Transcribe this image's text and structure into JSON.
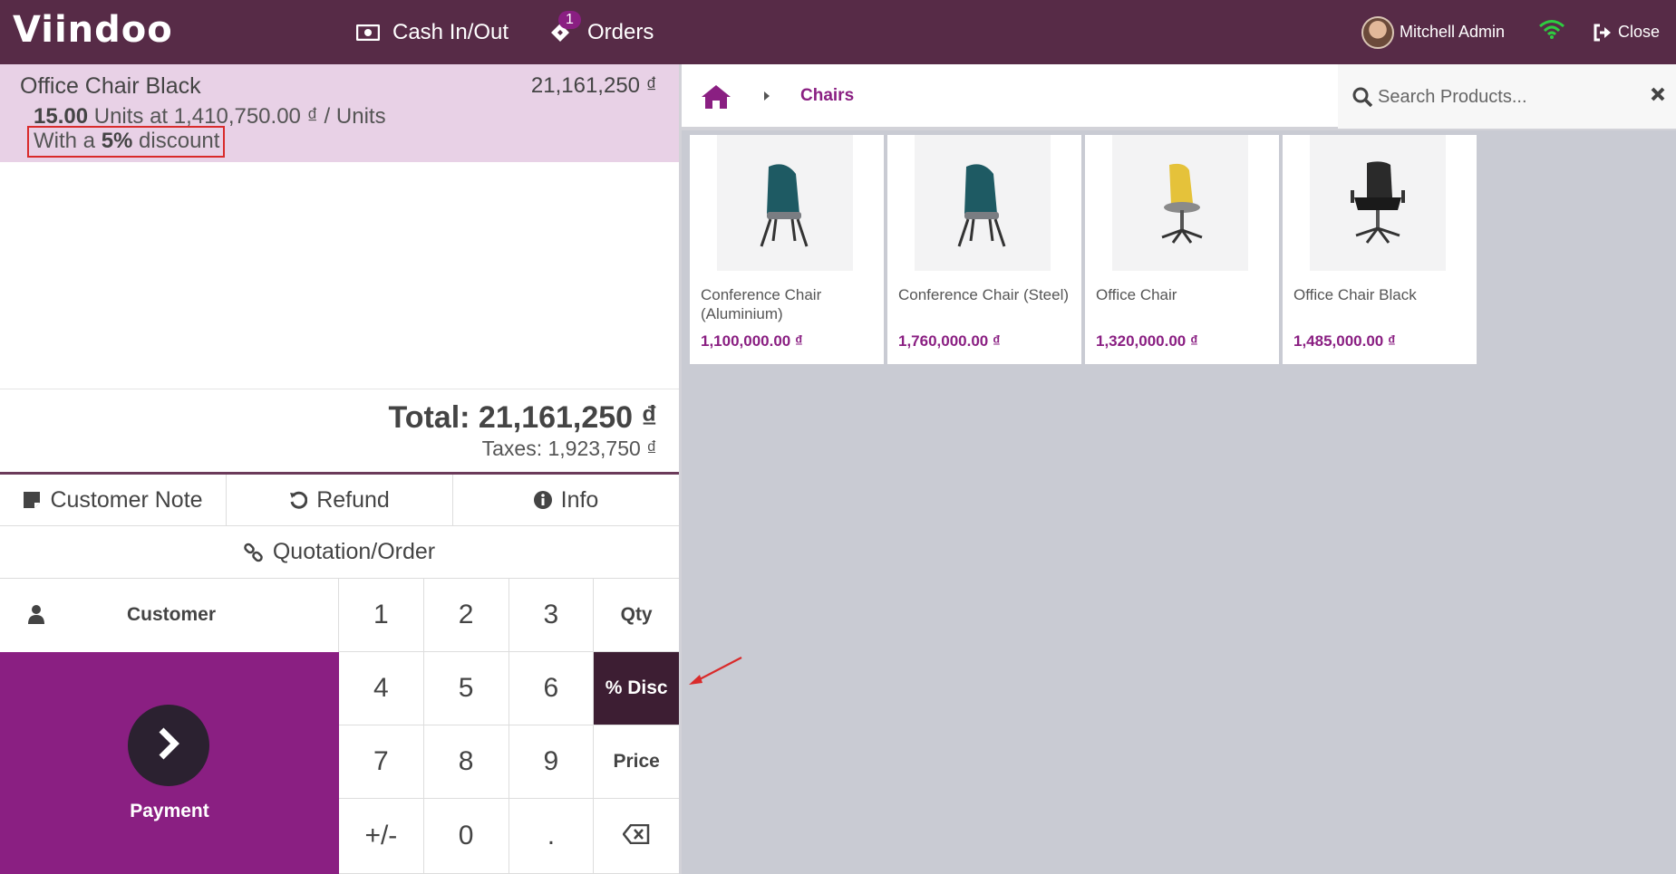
{
  "header": {
    "logo": "Viindoo",
    "cash_in_out": "Cash In/Out",
    "orders": "Orders",
    "orders_badge": "1",
    "user_name": "Mitchell Admin",
    "close": "Close"
  },
  "order": {
    "line": {
      "name": "Office Chair Black",
      "price": "21,161,250 ₫",
      "qty": "15.00",
      "qty_suffix": " Units at 1,410,750.00 ₫ / Units",
      "discount_prefix": "With a ",
      "discount_value": "5%",
      "discount_suffix": " discount"
    },
    "total": "Total: 21,161,250 ₫",
    "taxes": "Taxes: 1,923,750 ₫"
  },
  "actions": {
    "customer_note": "Customer Note",
    "refund": "Refund",
    "info": "Info",
    "quotation": "Quotation/Order"
  },
  "pad": {
    "customer": "Customer",
    "payment": "Payment",
    "keys": [
      "1",
      "2",
      "3",
      "Qty",
      "4",
      "5",
      "6",
      "% Disc",
      "7",
      "8",
      "9",
      "Price",
      "+/-",
      "0",
      "."
    ]
  },
  "products_panel": {
    "breadcrumb": "Chairs",
    "search_placeholder": "Search Products...",
    "items": [
      {
        "name": "Conference Chair (Aluminium)",
        "price": "1,100,000.00 ₫"
      },
      {
        "name": "Conference Chair (Steel)",
        "price": "1,760,000.00 ₫"
      },
      {
        "name": "Office Chair",
        "price": "1,320,000.00 ₫"
      },
      {
        "name": "Office Chair Black",
        "price": "1,485,000.00 ₫"
      }
    ]
  },
  "colors": {
    "topbar": "#572b47",
    "accent": "#8a1f82",
    "active_key": "#3d1e33",
    "order_line_bg": "#e8d1e6",
    "highlight": "#d92b2b"
  }
}
